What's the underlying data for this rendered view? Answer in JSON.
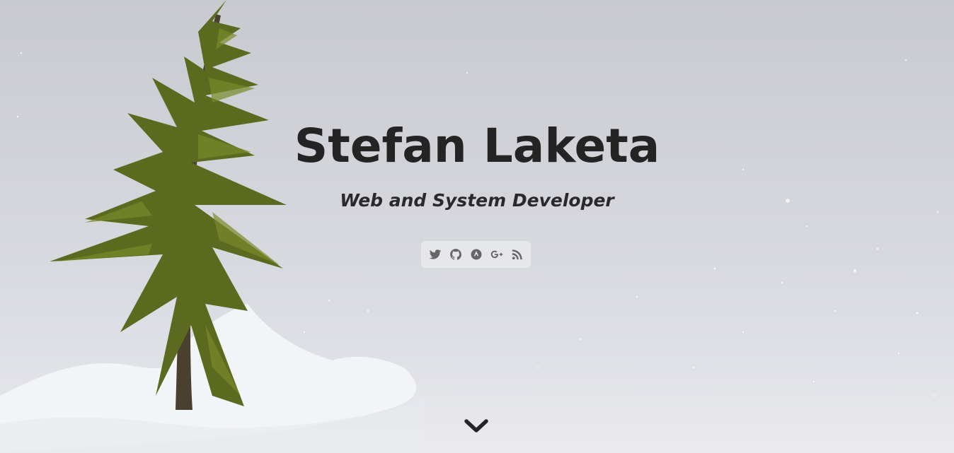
{
  "hero": {
    "title": "Stefan Laketa",
    "subtitle": "Web and System Developer"
  },
  "social_links": [
    {
      "icon": "twitter-icon",
      "name": "Twitter"
    },
    {
      "icon": "github-icon",
      "name": "GitHub"
    },
    {
      "icon": "archlinux-icon",
      "name": "Arch Linux"
    },
    {
      "icon": "google-plus-icon",
      "name": "Google+"
    },
    {
      "icon": "rss-icon",
      "name": "RSS"
    }
  ],
  "scroll_down": {
    "icon": "chevron-down-icon"
  },
  "colors": {
    "title": "#242424",
    "icon": "#666666",
    "background": "#d4d5db",
    "tree": "#4a5a1a"
  }
}
